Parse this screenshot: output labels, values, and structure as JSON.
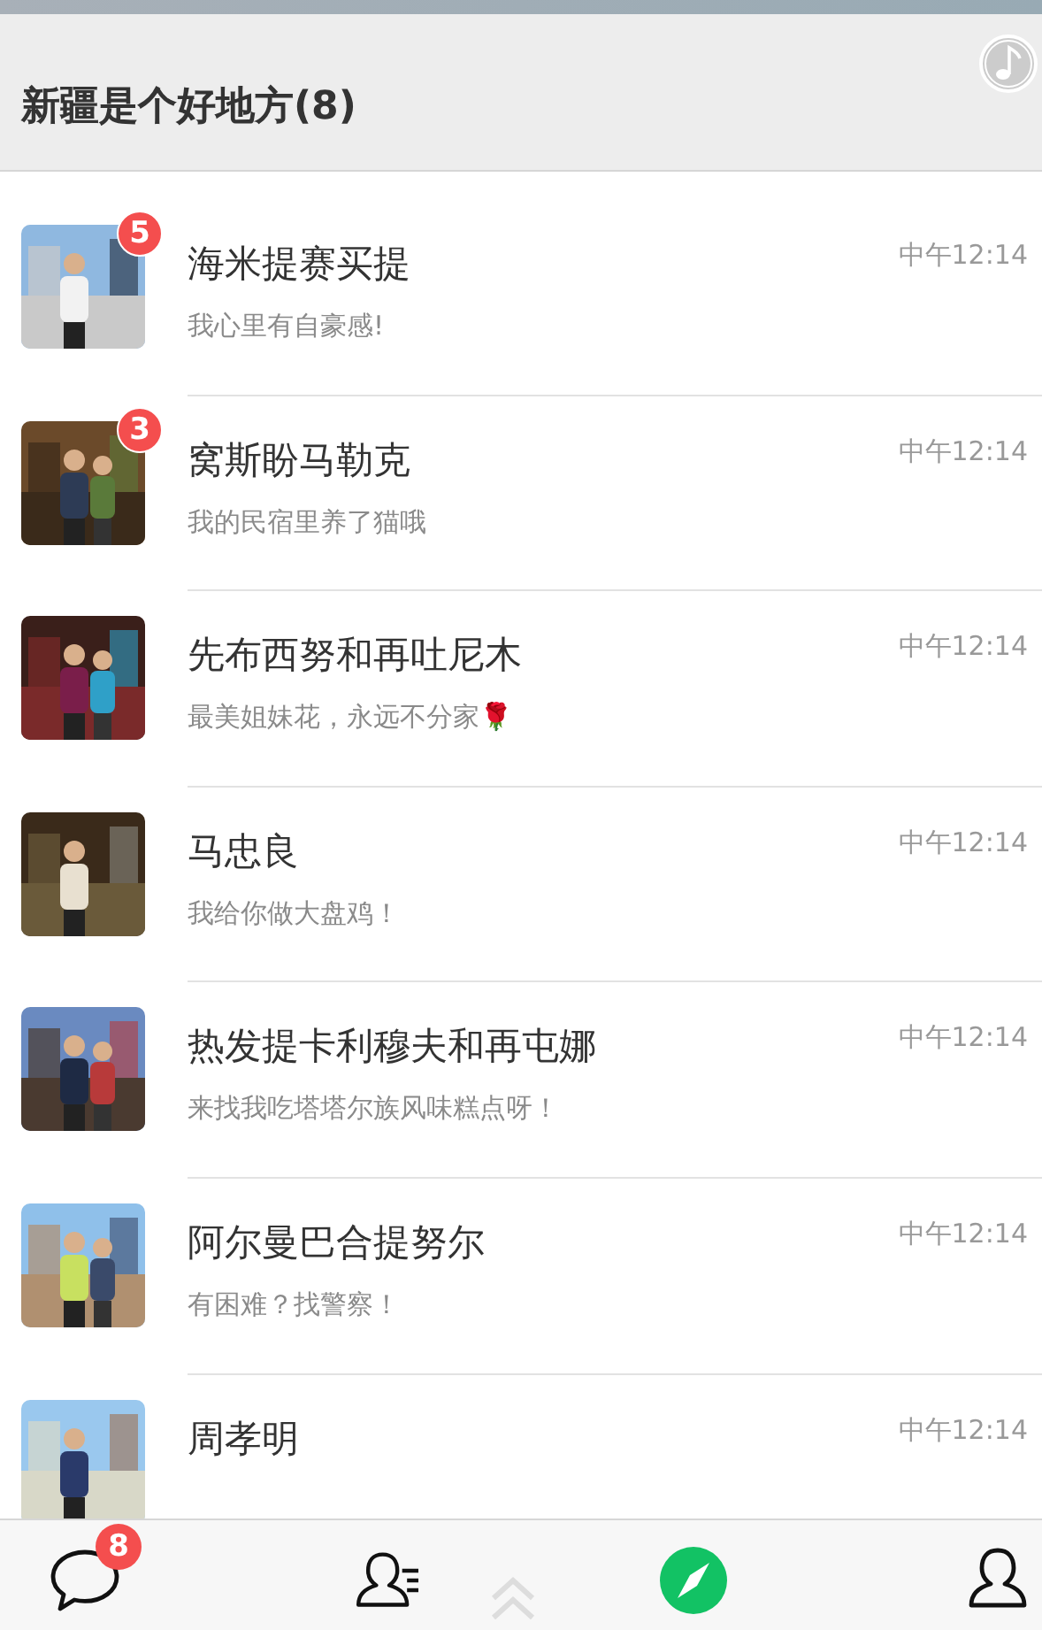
{
  "header": {
    "title": "新疆是个好地方(8)"
  },
  "chats": [
    {
      "name": "海米提赛买提",
      "time": "中午12:14",
      "preview": "我心里有自豪感!",
      "badge": "5"
    },
    {
      "name": "窝斯盼马勒克",
      "time": "中午12:14",
      "preview": "我的民宿里养了猫哦",
      "badge": "3"
    },
    {
      "name": "先布西努和再吐尼木",
      "time": "中午12:14",
      "preview": "最美姐妹花，永远不分家🌹"
    },
    {
      "name": "马忠良",
      "time": "中午12:14",
      "preview": "我给你做大盘鸡！"
    },
    {
      "name": "热发提卡利穆夫和再屯娜",
      "time": "中午12:14",
      "preview": "来找我吃塔塔尔族风味糕点呀！"
    },
    {
      "name": "阿尔曼巴合提努尔",
      "time": "中午12:14",
      "preview": "有困难？找警察！"
    },
    {
      "name": "周孝明",
      "time": "中午12:14"
    }
  ],
  "tab_bar": [
    {
      "kind": "chats",
      "selected": false,
      "badge": "8"
    },
    {
      "kind": "contacts",
      "selected": false
    },
    {
      "kind": "discover",
      "selected": true
    },
    {
      "kind": "me",
      "selected": false
    }
  ]
}
